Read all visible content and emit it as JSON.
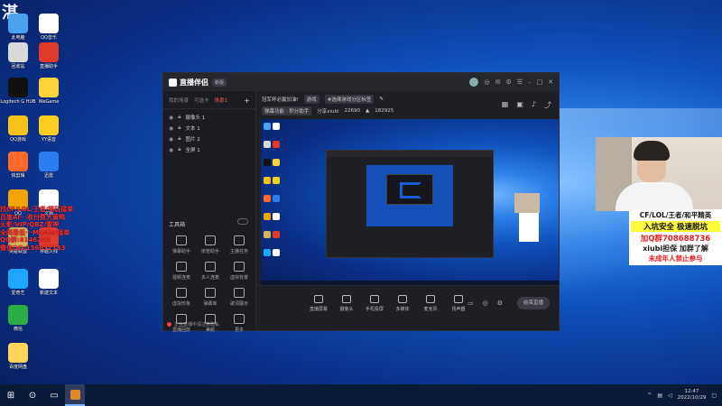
{
  "desktop": {
    "corner_text": "湛",
    "icons": [
      {
        "label": "此电脑",
        "color": "#4aa3f0"
      },
      {
        "label": "QQ音乐",
        "color": "#ffffff"
      },
      {
        "label": "回收站",
        "color": "#d9d9d9"
      },
      {
        "label": "直播助手",
        "color": "#e23a2a"
      },
      {
        "label": "Logitech G HUB",
        "color": "#111111"
      },
      {
        "label": "WeGame",
        "color": "#ffd23a"
      },
      {
        "label": "QQ游戏",
        "color": "#f7c21a"
      },
      {
        "label": "YY语音",
        "color": "#ffcd21"
      },
      {
        "label": "快剪辑",
        "color": "#ff6a2a"
      },
      {
        "label": "迅雷",
        "color": "#2c7df2"
      },
      {
        "label": "QQ",
        "color": "#f3a400"
      },
      {
        "label": "文档",
        "color": "#ffffff"
      },
      {
        "label": "英雄联盟",
        "color": "#d7b35a"
      },
      {
        "label": "穿越火线",
        "color": "#e23a2a"
      },
      {
        "label": "爱奇艺",
        "color": "#1ea7ff"
      },
      {
        "label": "新建文本",
        "color": "#ffffff"
      },
      {
        "label": "微信",
        "color": "#2aae44"
      },
      {
        "label": "百度网盘",
        "color": "#ffd45a"
      }
    ]
  },
  "overlay_lines": [
    "找CF/LOL/王者/陪玩接单",
    "百度AI···收付费大黄鸭",
    "火影/VIP/QBZ/雷神",
    "全网最低···Master接单",
    "QQ群:8146235",
    "微信QQ:156632183"
  ],
  "app": {
    "title": "直播伴侣",
    "version_badge": "新版",
    "tabs": [
      "我的场景",
      "可选卡",
      "场景1"
    ],
    "active_tab_index": 2,
    "sources": [
      "摄像头 1",
      "文本 1",
      "图片 2",
      "全屏 1"
    ],
    "tools_title": "工具箱",
    "tools": [
      "弹幕助手",
      "房管助手",
      "主播任务",
      "视频连麦",
      "多人连麦",
      "虚拟背景",
      "虚拟形象",
      "弹幕库",
      "歌词展示",
      "直播回放",
      "美颜",
      "更多"
    ],
    "notice": "正在直播中请注意隐私",
    "room_title": "冠军杯必赢加油!",
    "category_chip": "游戏",
    "room_chip": "#选择游戏分区标签",
    "info_row2_label": "弹幕功能 · 积分助手",
    "info_row2_mid": "分享xiubi",
    "viewer_count": "22690",
    "likes_count": "182925",
    "bottom_tools": [
      "直播屏幕",
      "摄像头",
      "手机投屏",
      "多媒体",
      "麦克风",
      "扬声器"
    ],
    "start_live_label": "结束直播"
  },
  "promo": {
    "line1": "CF/LOL/王者/和平精英",
    "line2": "入坑安全 极速脱坑",
    "line3": "加Q群708688736",
    "line4": "xiubi担保 加群了解",
    "line5": "未成年人禁止参与"
  },
  "taskbar": {
    "time": "12:47",
    "date": "2022/10/29"
  }
}
